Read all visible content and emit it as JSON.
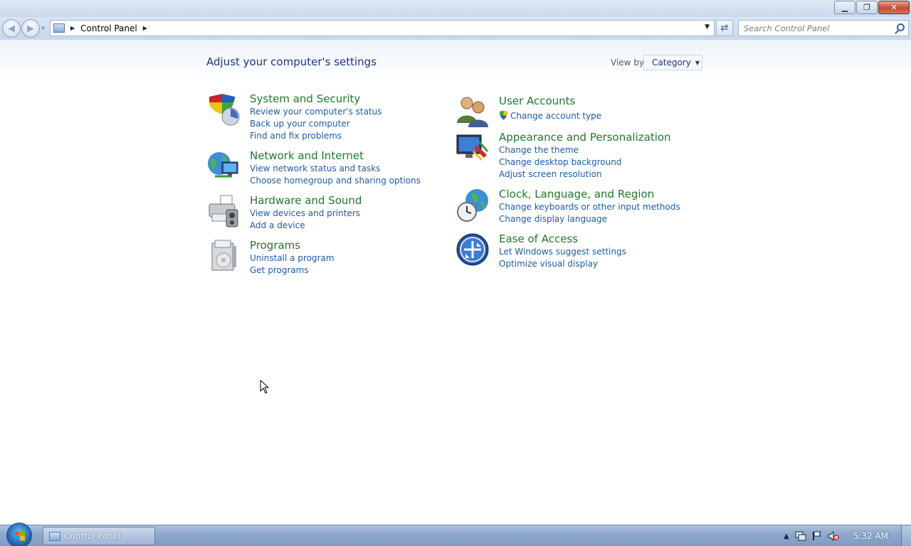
{
  "window": {
    "caption_buttons": [
      "minimize-icon",
      "restore-icon",
      "close-icon"
    ],
    "close_glyph": "✕"
  },
  "navbar": {
    "address_path": "Control Panel",
    "search_placeholder": "Search Control Panel"
  },
  "page": {
    "title": "Adjust your computer's settings",
    "view_by_label": "View by:",
    "view_by_value": "Category"
  },
  "categories": [
    {
      "title": "System and Security",
      "icon": "shield-icon",
      "links": [
        "Review your computer's status",
        "Back up your computer",
        "Find and fix problems"
      ]
    },
    {
      "title": "Network and Internet",
      "icon": "network-globe-icon",
      "links": [
        "View network status and tasks",
        "Choose homegroup and sharing options"
      ]
    },
    {
      "title": "Hardware and Sound",
      "icon": "printer-speaker-icon",
      "links": [
        "View devices and printers",
        "Add a device"
      ]
    },
    {
      "title": "Programs",
      "icon": "programs-box-icon",
      "links": [
        "Uninstall a program",
        "Get programs"
      ]
    },
    {
      "title": "User Accounts",
      "icon": "users-icon",
      "links": [
        "Change account type"
      ]
    },
    {
      "title": "Appearance and Personalization",
      "icon": "monitor-palette-icon",
      "links": [
        "Change the theme",
        "Change desktop background",
        "Adjust screen resolution"
      ]
    },
    {
      "title": "Clock, Language, and Region",
      "icon": "clock-globe-icon",
      "links": [
        "Change keyboards or other input methods",
        "Change display language"
      ]
    },
    {
      "title": "Ease of Access",
      "icon": "ease-of-access-icon",
      "links": [
        "Let Windows suggest settings",
        "Optimize visual display"
      ]
    }
  ],
  "taskbar": {
    "task_button_label": "Control Panel",
    "clock": "5:32 AM",
    "tray_icons": [
      "show-hidden-icons-arrow",
      "network-icon",
      "action-center-flag-icon",
      "volume-muted-icon"
    ]
  },
  "colors": {
    "category_title": "#1e7a2a",
    "link": "#1e5ba8",
    "page_title": "#1e3287"
  }
}
